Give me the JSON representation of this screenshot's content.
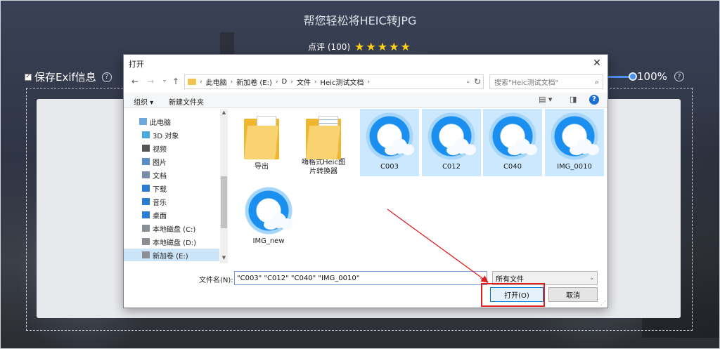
{
  "app": {
    "title": "帮您轻松将HEIC转JPG",
    "rating_label": "点评 (100)",
    "stars": "★★★★★",
    "exif_label": "保存Exif信息",
    "exif_checkbox_mark": "✓",
    "help_glyph": "?",
    "quality_value": "100%"
  },
  "dialog": {
    "title": "打开",
    "close_glyph": "✕",
    "nav": {
      "back": "←",
      "forward": "→",
      "recent": "⌄",
      "up": "↑"
    },
    "address": {
      "sep": "›",
      "crumbs": [
        "此电脑",
        "新加卷 (E:)",
        "D",
        "文件",
        "Heic测试文档"
      ],
      "dropdown": "⌄",
      "refresh": "↻"
    },
    "search_placeholder": "搜索\"Heic测试文档\"",
    "search_icon": "⌕",
    "toolbar": {
      "organize": "组织 ▾",
      "new_folder": "新建文件夹",
      "view_icon": "▤ ▾",
      "pane_icon": "◨",
      "help": "?"
    },
    "nav_items": [
      {
        "label": "此电脑",
        "icon": "computer-icon",
        "color": "#6fa8dc"
      },
      {
        "label": "3D 对象",
        "icon": "cube-icon",
        "color": "#47a9e0"
      },
      {
        "label": "视频",
        "icon": "video-icon",
        "color": "#555555"
      },
      {
        "label": "图片",
        "icon": "pictures-icon",
        "color": "#5b8cc7"
      },
      {
        "label": "文档",
        "icon": "documents-icon",
        "color": "#7a8ea8"
      },
      {
        "label": "下载",
        "icon": "download-icon",
        "color": "#2b7cd3"
      },
      {
        "label": "音乐",
        "icon": "music-icon",
        "color": "#2b7cd3"
      },
      {
        "label": "桌面",
        "icon": "desktop-icon",
        "color": "#2b7cd3"
      },
      {
        "label": "本地磁盘 (C:)",
        "icon": "drive-icon",
        "color": "#8a8f96"
      },
      {
        "label": "本地磁盘 (D:)",
        "icon": "drive-icon",
        "color": "#8a8f96"
      },
      {
        "label": "新加卷 (E:)",
        "icon": "drive-icon",
        "color": "#8a8f96"
      }
    ],
    "selected_nav_index": 10,
    "files": [
      {
        "name": "导出",
        "kind": "folder",
        "selected": false
      },
      {
        "name": "嗨格式Heic图片转换器",
        "kind": "folder",
        "selected": false
      },
      {
        "name": "C003",
        "kind": "image",
        "selected": true
      },
      {
        "name": "C012",
        "kind": "image",
        "selected": true
      },
      {
        "name": "C040",
        "kind": "image",
        "selected": true
      },
      {
        "name": "IMG_0010",
        "kind": "image",
        "selected": true
      },
      {
        "name": "IMG_new",
        "kind": "image",
        "selected": false
      }
    ],
    "filename_label": "文件名(N):",
    "filename_value": "\"C003\" \"C012\" \"C040\" \"IMG_0010\"",
    "filename_chev": "⌄",
    "filetype_value": "所有文件",
    "open_button": "打开(O)",
    "cancel_button": "取消",
    "scroll_up": "▲",
    "scroll_down": "▼",
    "grip": "⋰",
    "annotation_color": "#e02020"
  }
}
